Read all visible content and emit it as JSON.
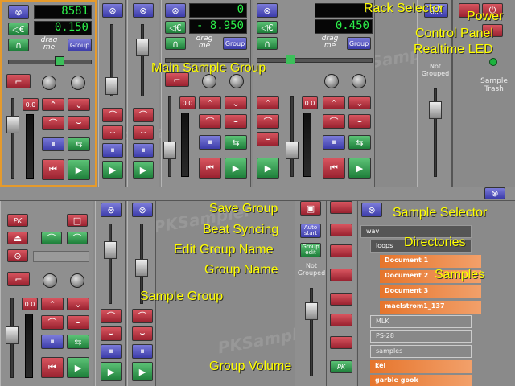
{
  "colors": {
    "annotation": "#ffff00",
    "lcd": "#2cf04a",
    "accent_selected": "#e59a2c",
    "list_orange": "#e6752c"
  },
  "strip1": {
    "lcd_top": "8581",
    "lcd_bottom": "0.150",
    "drag_label": "drag me",
    "group_label": "Group",
    "level_label": "0.0"
  },
  "strip2": {
    "lcd_top": "0",
    "lcd_bottom": "- 8.950",
    "drag_label": "drag me",
    "group_label": "Group",
    "level_label": "0.0"
  },
  "strip3": {
    "lcd_top": "",
    "lcd_bottom": "0.450",
    "drag_label": "drag me",
    "group_label": "Group",
    "level_label": "0.0"
  },
  "group_panel": {
    "auto_label": "Auto start",
    "group_status": "Not Grouped"
  },
  "trash": {
    "label": "Sample Trash"
  },
  "bottom": {
    "pk_label": "PK",
    "level_label": "0.0",
    "auto_label": "Auto start",
    "edit_label": "Group edit",
    "group_status": "Not Grouped",
    "pk2_label": "PK"
  },
  "selector": {
    "rows": [
      {
        "text": "wav",
        "style": "dark"
      },
      {
        "text": "loops",
        "style": "gray"
      },
      {
        "text": "Document 1",
        "style": "orange"
      },
      {
        "text": "Document 2",
        "style": "orange"
      },
      {
        "text": "Document 3",
        "style": "orange"
      },
      {
        "text": "maelstrom1_137",
        "style": "orange"
      },
      {
        "text": "MLK",
        "style": "gray"
      },
      {
        "text": "PS-28",
        "style": "gray"
      },
      {
        "text": "samples",
        "style": "gray"
      },
      {
        "text": "kel",
        "style": "orange"
      },
      {
        "text": "garble gook",
        "style": "orange"
      }
    ]
  },
  "watermark": "PKSampler",
  "annotations": {
    "rack_selector": "Rack Selector",
    "power": "Power",
    "control_panel": "Control Panel",
    "realtime_led": "Realtime LED",
    "main_sample_group": "Main Sample Group",
    "save_group": "Save Group",
    "beat_syncing": "Beat Syncing",
    "edit_group_name": "Edit Group Name",
    "group_name": "Group Name",
    "sample_group": "Sample Group",
    "group_volume": "Group Volume",
    "sample_selector": "Sample Selector",
    "directories": "Directories",
    "samples": "Samples"
  }
}
